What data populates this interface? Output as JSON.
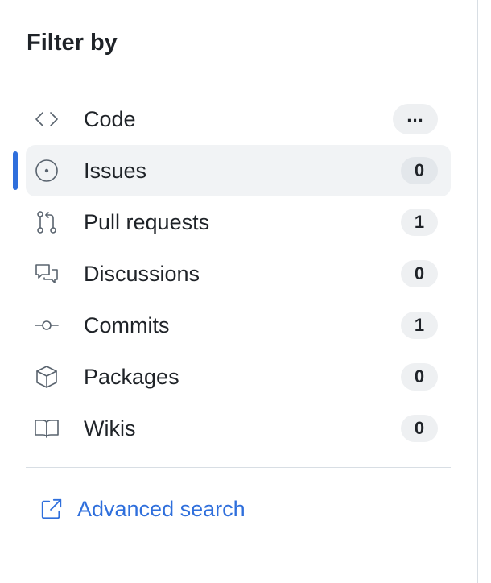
{
  "filter": {
    "title": "Filter by",
    "items": [
      {
        "label": "Code",
        "count": "...",
        "icon": "code-icon",
        "selected": false
      },
      {
        "label": "Issues",
        "count": "0",
        "icon": "issue-circle-icon",
        "selected": true
      },
      {
        "label": "Pull requests",
        "count": "1",
        "icon": "pull-request-icon",
        "selected": false
      },
      {
        "label": "Discussions",
        "count": "0",
        "icon": "discussion-icon",
        "selected": false
      },
      {
        "label": "Commits",
        "count": "1",
        "icon": "commit-icon",
        "selected": false
      },
      {
        "label": "Packages",
        "count": "0",
        "icon": "package-icon",
        "selected": false
      },
      {
        "label": "Wikis",
        "count": "0",
        "icon": "book-icon",
        "selected": false
      }
    ]
  },
  "advanced_search": {
    "label": "Advanced search",
    "icon": "external-link-icon"
  },
  "colors": {
    "accent": "#2f6fdc",
    "selected_bg": "#f1f3f5",
    "badge_bg": "#eef0f2",
    "icon": "#59636e",
    "text": "#1f2328"
  }
}
